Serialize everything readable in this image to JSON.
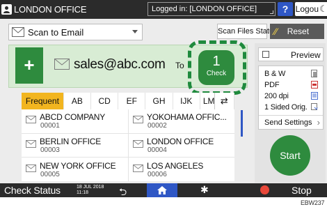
{
  "topbar": {
    "user_name": "LONDON OFFICE",
    "login_status": "Logged in: [LONDON OFFICE]",
    "help_label": "?",
    "logout_label": "Logout",
    "moon_label": "☾"
  },
  "toolbar": {
    "scan_mode": "Scan to Email",
    "scan_files_status_label": "Scan Files Status",
    "reset_label": "Reset"
  },
  "destination": {
    "add_label": "+",
    "address": "sales@abc.com",
    "to_label": "To",
    "check_count": "1",
    "check_label": "Check"
  },
  "tabs": [
    "Frequent",
    "AB",
    "CD",
    "EF",
    "GH",
    "IJK",
    "LM"
  ],
  "tab_switch_icon": "⇄",
  "entries": [
    {
      "name": "ABCD COMPANY",
      "num": "00001"
    },
    {
      "name": "YOKOHAMA OFFIC...",
      "num": "00002"
    },
    {
      "name": "BERLIN OFFICE",
      "num": "00003"
    },
    {
      "name": "LONDON OFFICE",
      "num": "00004"
    },
    {
      "name": "NEW YORK OFFICE",
      "num": "00005"
    },
    {
      "name": "LOS ANGELES",
      "num": "00006"
    }
  ],
  "settings": {
    "preview_label": "Preview",
    "color": "B & W",
    "format": "PDF",
    "resolution": "200 dpi",
    "orig": "1 Sided Orig.",
    "send_settings_label": "Send Settings",
    "start_label": "Start"
  },
  "bottombar": {
    "check_status_label": "Check Status",
    "date": "18 JUL 2018",
    "time": "11:18",
    "stop_label": "Stop"
  },
  "footer_code": "EBW237",
  "colors": {
    "accent_green": "#2e8b3e",
    "accent_blue": "#2f57c5",
    "tab_active": "#f2b51f",
    "bar_dark": "#2b2b2b"
  }
}
